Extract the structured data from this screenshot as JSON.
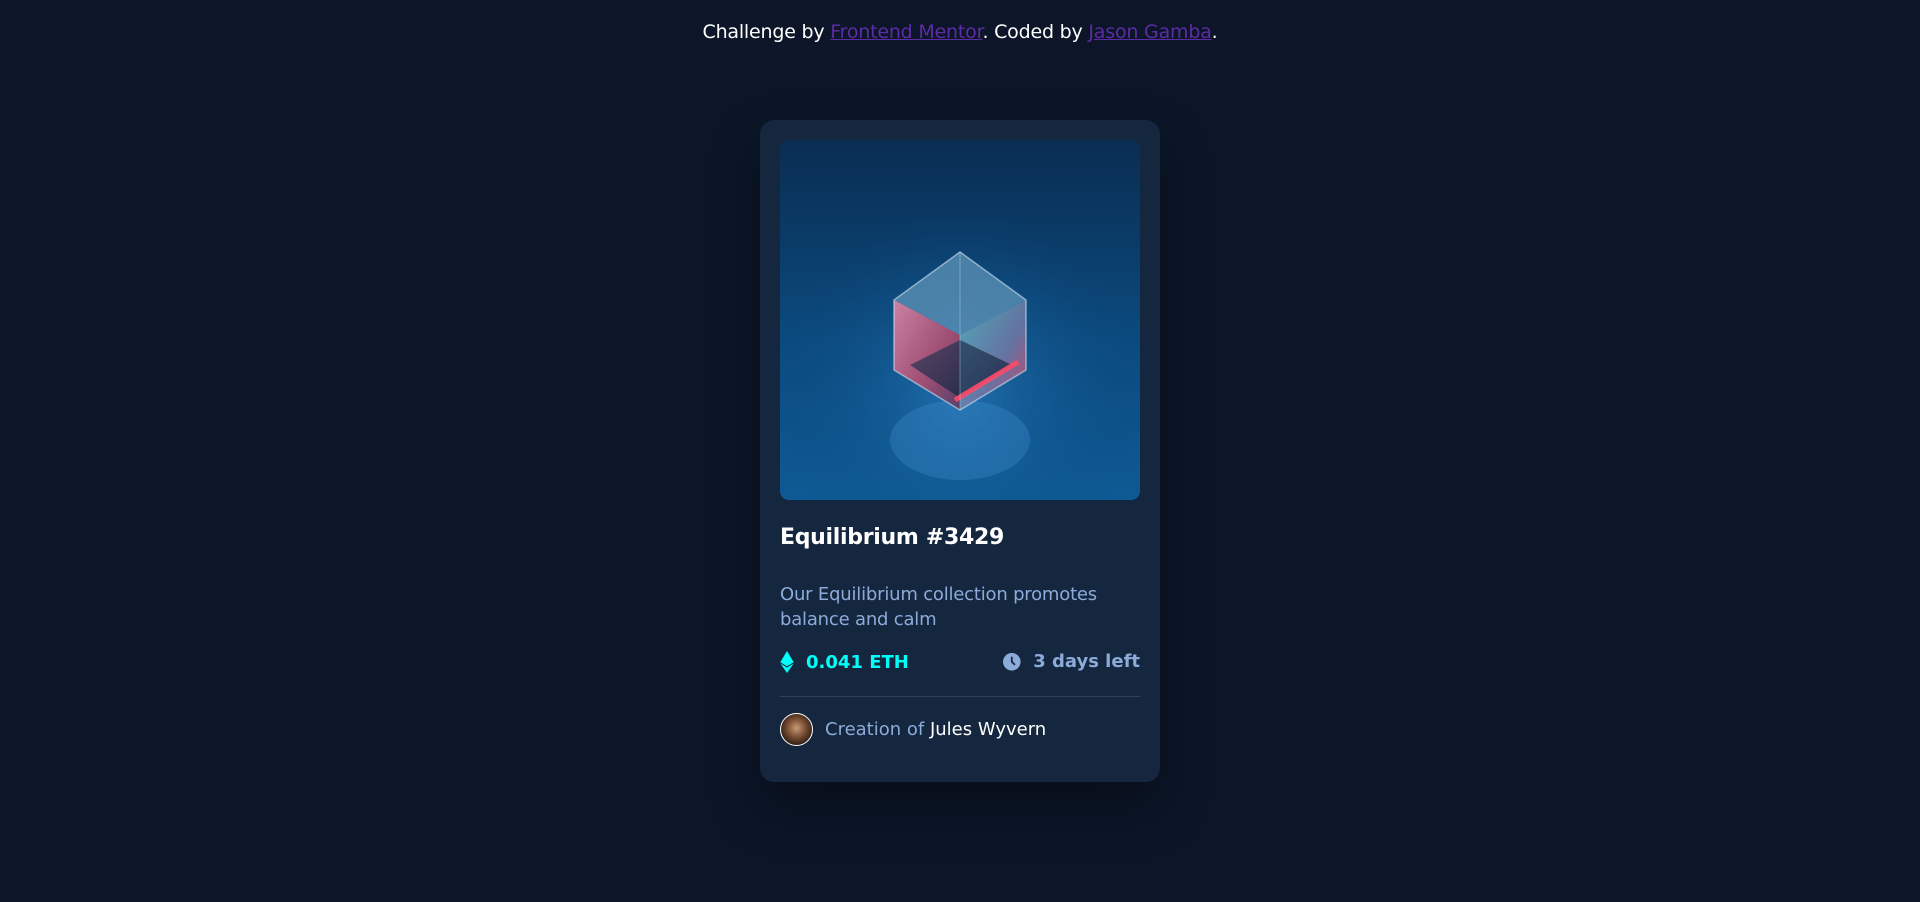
{
  "attribution": {
    "prefix": "Challenge by ",
    "challenge_link": "Frontend Mentor",
    "middle": ". Coded by ",
    "author_link": "Jason Gamba",
    "suffix": "."
  },
  "card": {
    "image_alt": "Equilibrium crystal cube",
    "title": "Equilibrium #3429",
    "description": "Our Equilibrium collection promotes balance and calm",
    "price": "0.041 ETH",
    "time_left": "3 days left",
    "creator_prefix": "Creation of",
    "creator_name": "Jules Wyvern"
  },
  "icons": {
    "price": "ethereum-icon",
    "time": "clock-icon"
  },
  "colors": {
    "background": "#0c1628",
    "card": "#15263f",
    "accent_cyan": "#00fff8",
    "soft_blue": "#8bacd9",
    "link_purple": "#5b2ca3",
    "white": "#ffffff"
  }
}
